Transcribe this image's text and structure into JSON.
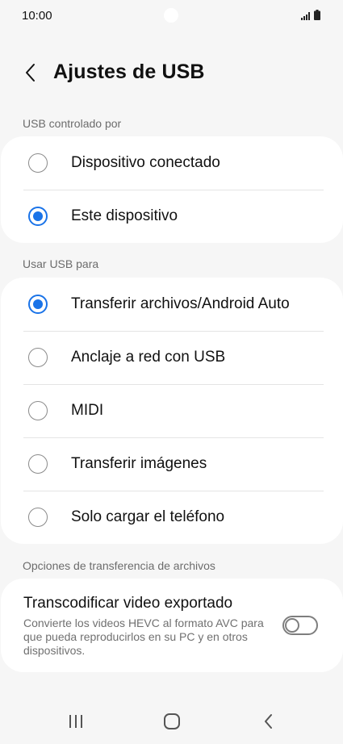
{
  "status_bar": {
    "time": "10:00"
  },
  "header": {
    "title": "Ajustes de USB"
  },
  "section_controlled": {
    "label": "USB controlado por",
    "options": [
      {
        "label": "Dispositivo conectado",
        "selected": false
      },
      {
        "label": "Este dispositivo",
        "selected": true
      }
    ]
  },
  "section_usage": {
    "label": "Usar USB para",
    "options": [
      {
        "label": "Transferir archivos/Android Auto",
        "selected": true
      },
      {
        "label": "Anclaje a red con USB",
        "selected": false
      },
      {
        "label": "MIDI",
        "selected": false
      },
      {
        "label": "Transferir imágenes",
        "selected": false
      },
      {
        "label": "Solo cargar el teléfono",
        "selected": false
      }
    ]
  },
  "section_transfer": {
    "label": "Opciones de transferencia de archivos",
    "toggle": {
      "title": "Transcodificar video exportado",
      "description": "Convierte los videos HEVC al formato AVC para que pueda reproducirlos en su PC y en otros dispositivos.",
      "enabled": false
    }
  },
  "colors": {
    "accent": "#1a73e8",
    "background": "#f6f6f6",
    "card": "#ffffff"
  },
  "icons": {
    "back": "chevron-left-icon",
    "signal": "signal-icon",
    "battery": "battery-icon",
    "recents": "recents-icon",
    "home": "home-icon",
    "nav_back": "nav-back-icon"
  }
}
